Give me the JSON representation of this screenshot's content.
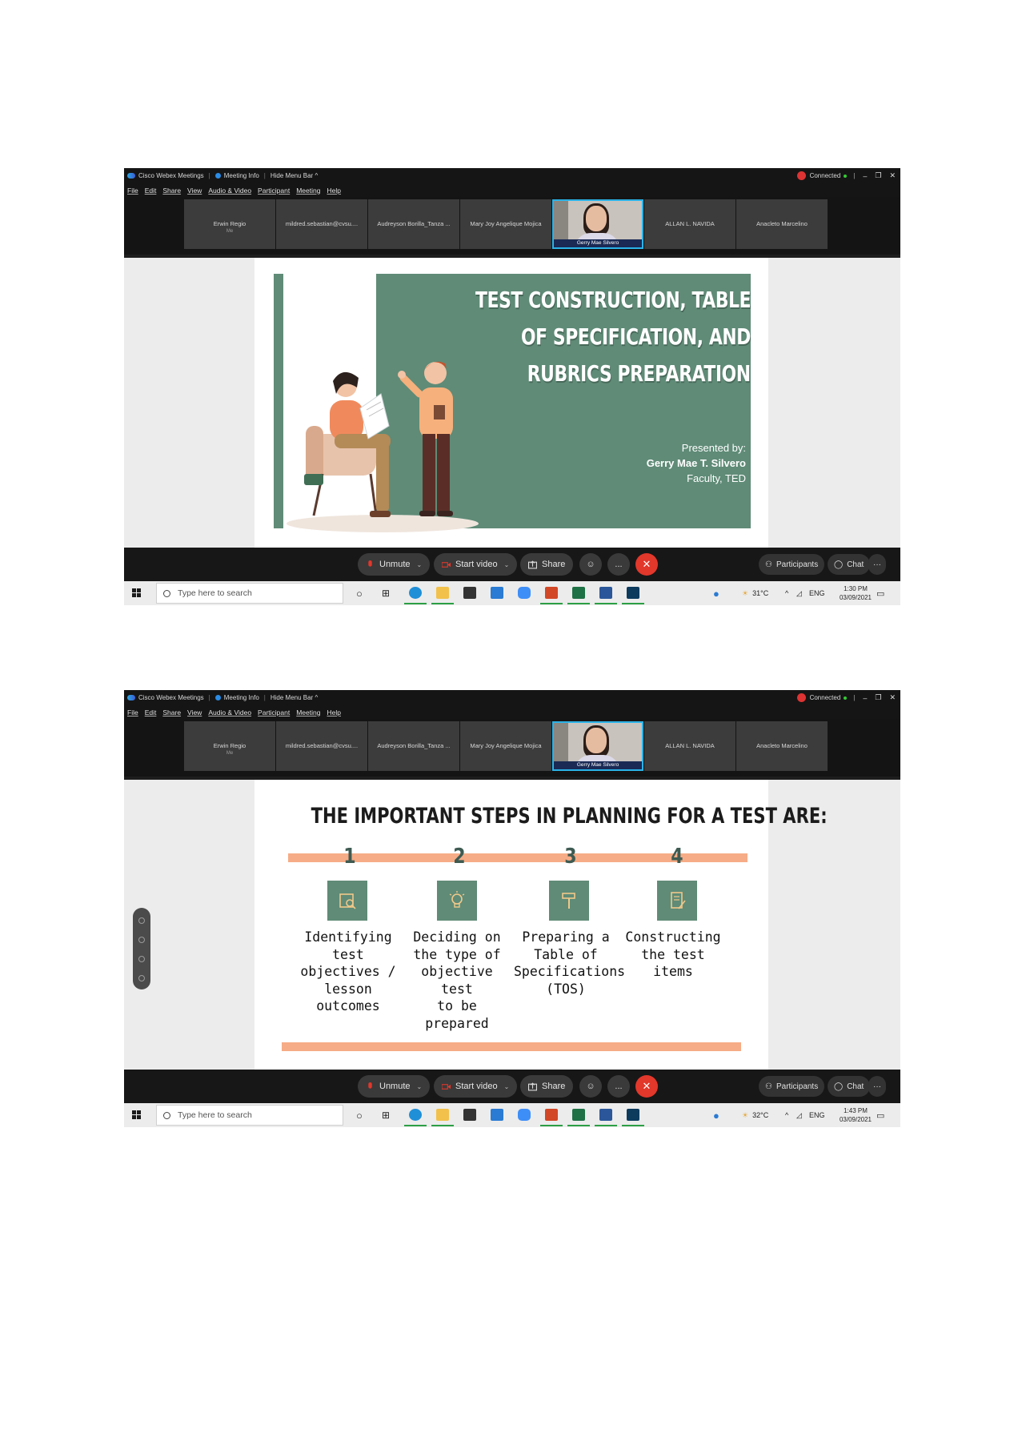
{
  "screens": [
    {
      "titlebar": {
        "app": "Cisco Webex Meetings",
        "info": "Meeting Info",
        "hide": "Hide Menu Bar ^",
        "status": "Connected"
      },
      "menu": [
        "File",
        "Edit",
        "Share",
        "View",
        "Audio & Video",
        "Participant",
        "Meeting",
        "Help"
      ],
      "participants": [
        {
          "name": "Erwin Regio",
          "sub": "Me"
        },
        {
          "name": "mildred.sebastian@cvsu...."
        },
        {
          "name": "Audreyson Borilla_Tanza ..."
        },
        {
          "name": "Mary Joy Angelique Mojica"
        },
        {
          "name": "Gerry Mae Silvero",
          "video": true
        },
        {
          "name": "ALLAN L. NAVIDA"
        },
        {
          "name": "Anacleto Marcelino"
        }
      ],
      "slide": {
        "title_lines": [
          "TEST CONSTRUCTION, TABLE",
          "OF SPECIFICATION, AND",
          "RUBRICS PREPARATION"
        ],
        "presented_by": "Presented by:",
        "presenter": "Gerry Mae T. Silvero",
        "role": "Faculty, TED"
      },
      "controls": {
        "unmute": "Unmute",
        "start_video": "Start video",
        "share": "Share",
        "more": "...",
        "participants": "Participants",
        "chat": "Chat"
      },
      "taskbar": {
        "search": "Type here to search",
        "temp": "31°C",
        "lang": "ENG",
        "time": "1:30 PM",
        "date": "03/09/2021"
      }
    },
    {
      "titlebar": {
        "app": "Cisco Webex Meetings",
        "info": "Meeting Info",
        "hide": "Hide Menu Bar ^",
        "status": "Connected"
      },
      "menu": [
        "File",
        "Edit",
        "Share",
        "View",
        "Audio & Video",
        "Participant",
        "Meeting",
        "Help"
      ],
      "participants": [
        {
          "name": "Erwin Regio",
          "sub": "Me"
        },
        {
          "name": "mildred.sebastian@cvsu...."
        },
        {
          "name": "Audreyson Borilla_Tanza ..."
        },
        {
          "name": "Mary Joy Angelique Mojica"
        },
        {
          "name": "Gerry Mae Silvero",
          "video": true
        },
        {
          "name": "ALLAN L. NAVIDA"
        },
        {
          "name": "Anacleto Marcelino"
        }
      ],
      "slide": {
        "heading": "THE IMPORTANT STEPS IN PLANNING FOR A TEST ARE:",
        "steps": [
          {
            "num": "1",
            "icon": "book-search-icon",
            "lines": [
              "Identifying",
              "test",
              "objectives /",
              "lesson",
              "outcomes"
            ]
          },
          {
            "num": "2",
            "icon": "lightbulb-icon",
            "lines": [
              "Deciding on",
              "the type of",
              "objective test",
              "to be",
              "prepared"
            ]
          },
          {
            "num": "3",
            "icon": "hammer-icon",
            "lines": [
              "Preparing a",
              "Table of",
              "Specifications",
              "(TOS)"
            ]
          },
          {
            "num": "4",
            "icon": "scroll-pen-icon",
            "lines": [
              "Constructing",
              "the test",
              "items"
            ]
          }
        ]
      },
      "controls": {
        "unmute": "Unmute",
        "start_video": "Start video",
        "share": "Share",
        "more": "...",
        "participants": "Participants",
        "chat": "Chat"
      },
      "taskbar": {
        "search": "Type here to search",
        "temp": "32°C",
        "lang": "ENG",
        "time": "1:43 PM",
        "date": "03/09/2021"
      }
    }
  ]
}
